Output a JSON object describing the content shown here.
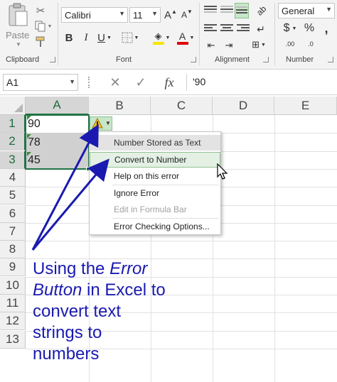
{
  "ribbon": {
    "paste_label": "Paste",
    "clipboard_label": "Clipboard",
    "font_group_label": "Font",
    "alignment_group_label": "Alignment",
    "number_group_label": "Number",
    "font_name": "Calibri",
    "font_size": "11",
    "number_format": "General",
    "bold": "B",
    "italic": "I",
    "underline": "U",
    "grow_font": "A",
    "shrink_font": "A",
    "font_color_glyph": "A",
    "currency": "$",
    "percent": "%",
    "comma": ",",
    "dec_inc": ".00",
    "dec_dec": ".0",
    "accent_color": "#217346"
  },
  "formula_bar": {
    "name_box": "A1",
    "fx": "fx",
    "cancel": "✕",
    "enter": "✓",
    "content": "'90"
  },
  "columns": [
    "A",
    "B",
    "C",
    "D",
    "E"
  ],
  "rows": [
    "1",
    "2",
    "3",
    "4",
    "5",
    "6",
    "7",
    "8",
    "9",
    "10",
    "11",
    "12",
    "13"
  ],
  "cells": {
    "a1": "90",
    "a2": "78",
    "a3": "45"
  },
  "error_menu": {
    "items": [
      "Number Stored as Text",
      "Convert to Number",
      "Help on this error",
      "Ignore Error",
      "Edit in Formula Bar",
      "Error Checking Options..."
    ]
  },
  "caption": {
    "line1_a": "Using the ",
    "line1_b": "Error",
    "line2_a": "Button",
    "line2_b": " in Excel to",
    "line3": "convert text",
    "line4": "strings to",
    "line5": "numbers"
  }
}
